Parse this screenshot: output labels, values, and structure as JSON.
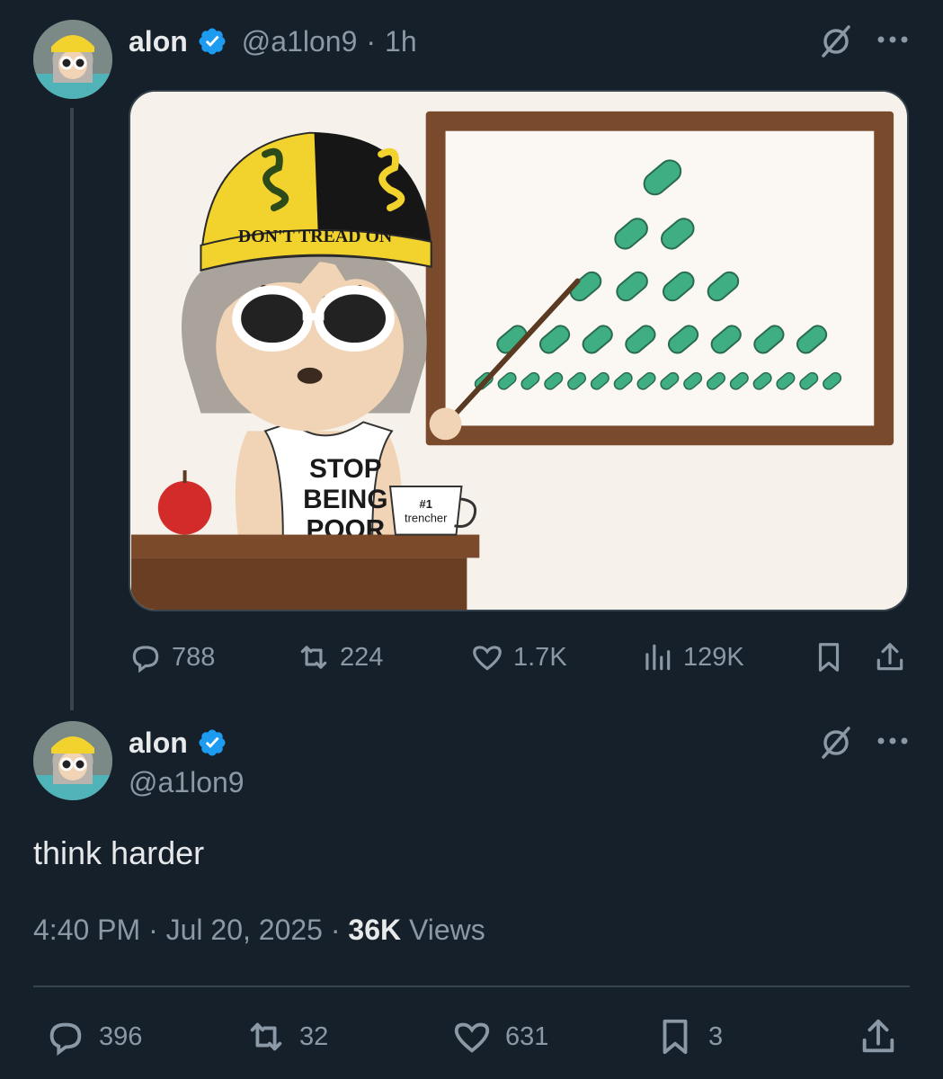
{
  "post1": {
    "name": "alon",
    "handle": "@a1lon9",
    "separator": "·",
    "time": "1h",
    "image": {
      "hat_text": "DON'T TREAD ON",
      "shirt_line1": "STOP",
      "shirt_line2": "BEING",
      "shirt_line3": "POOR",
      "mug_line1": "#1",
      "mug_line2": "trencher"
    },
    "actions": {
      "replies": "788",
      "reposts": "224",
      "likes": "1.7K",
      "views": "129K"
    }
  },
  "post2": {
    "name": "alon",
    "handle": "@a1lon9",
    "text": "think harder",
    "timestamp": "4:40 PM · Jul 20, 2025 · ",
    "views_count": "36K",
    "views_label": " Views",
    "actions": {
      "replies": "396",
      "reposts": "32",
      "likes": "631",
      "bookmarks": "3"
    }
  },
  "colors": {
    "background": "#15202b",
    "text": "#e7e9ea",
    "muted": "#8b98a5",
    "verified": "#1d9bf0",
    "border": "#38444d"
  },
  "icons": [
    "verified-badge-icon",
    "grok-icon",
    "more-icon",
    "reply-icon",
    "repost-icon",
    "like-icon",
    "views-icon",
    "bookmark-icon",
    "share-icon"
  ]
}
